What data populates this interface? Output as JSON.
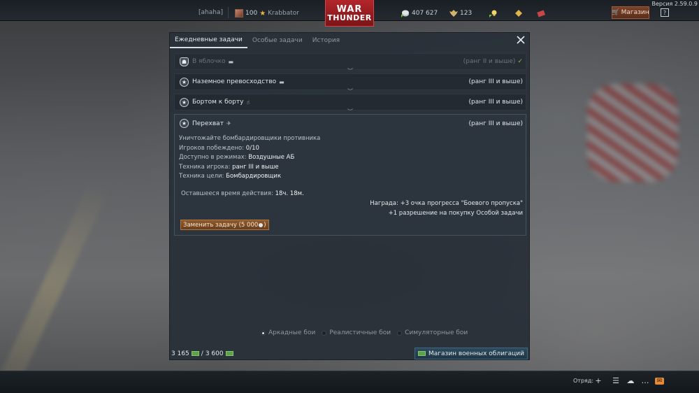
{
  "version": "Версия 2.59.0.9",
  "topbar": {
    "tag": "[ahaha]",
    "level": "100",
    "player": "Krabbator",
    "logo_line1": "WAR",
    "logo_line2": "THUNDER",
    "silver_lions": "407 627",
    "gold_eagles": "123",
    "shop_label": "Магазин",
    "help_label": "?"
  },
  "window": {
    "tabs": [
      "Ежедневные задачи",
      "Особые задачи",
      "История"
    ],
    "active_tab": 0,
    "tasks": [
      {
        "name": "В яблочко",
        "vehicle_icon": "tank-icon",
        "rank": "(ранг II и выше)",
        "completed": true,
        "badge": "shield-icon"
      },
      {
        "name": "Наземное превосходство",
        "vehicle_icon": "tank-icon",
        "rank": "(ранг III и выше)",
        "completed": false,
        "badge": "star-icon"
      },
      {
        "name": "Бортом к борту",
        "vehicle_icon": "hand-icon",
        "rank": "(ранг III и выше)",
        "completed": false,
        "badge": "star-icon"
      }
    ],
    "open_task": {
      "name": "Перехват",
      "vehicle_icon": "plane-icon",
      "rank": "(ранг III и выше)",
      "description": "Уничтожайте бомбардировщики противника",
      "details": [
        {
          "label": "Игроков побеждено: ",
          "value": "0/10"
        },
        {
          "label": "Доступно в режимах: ",
          "value": "Воздушные АБ"
        },
        {
          "label": "Техника игрока: ",
          "value": "ранг III и выше"
        },
        {
          "label": "Техника цели: ",
          "value": "Бомбардировщик"
        }
      ],
      "time_label": "Оставшееся время действия: ",
      "time_value": "18ч. 18м.",
      "reward_line1": "Награда: +3 очка прогресса \"Боевого пропуска\"",
      "reward_line2": "+1 разрешение на покупку Особой задачи",
      "replace_button": "Заменить задачу (5 000"
    },
    "modes": [
      {
        "label": "Аркадные бои",
        "selected": true
      },
      {
        "label": "Реалистичные бои",
        "selected": false
      },
      {
        "label": "Симуляторные бои",
        "selected": false
      }
    ],
    "bonds_current": "3 165",
    "bonds_separator": "/",
    "bonds_max": "3 600",
    "bond_shop_label": "Магазин военных облигаций"
  },
  "footer": {
    "squad_label": "Отряд:"
  },
  "colors": {
    "accent_orange": "#8f5a2b",
    "completed_green": "#7fbf4a",
    "logo_red": "#b3262b"
  }
}
